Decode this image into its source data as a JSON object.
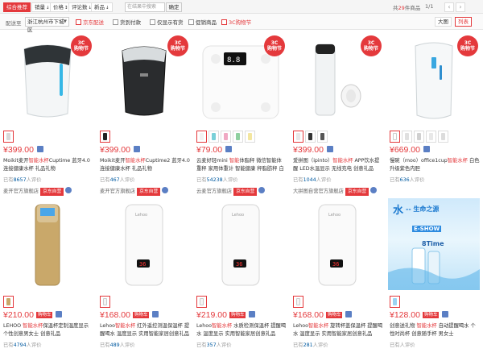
{
  "filters": {
    "sort": [
      {
        "label": "综合推荐",
        "active": true
      },
      {
        "label": "销量",
        "arrow": "↓"
      },
      {
        "label": "价格",
        "arrow": "↕"
      },
      {
        "label": "评论数",
        "arrow": "↓"
      },
      {
        "label": "新品",
        "arrow": "↓"
      }
    ],
    "search_placeholder": "在结果中搜索",
    "confirm_label": "确定",
    "count_prefix": "共",
    "count": "29",
    "count_suffix": "件商品",
    "page": "1/1",
    "prev": "‹",
    "next": "›"
  },
  "options": {
    "ship_label": "配送至",
    "location": "浙江杭州市下城区",
    "checks": [
      {
        "label": "京东配送",
        "red": true
      },
      {
        "label": "货到付款"
      },
      {
        "label": "仅显示有货"
      },
      {
        "label": "促销商品"
      },
      {
        "label": "3C购物节",
        "red": true
      }
    ],
    "view_large": "大图",
    "view_list": "列表"
  },
  "products": [
    {
      "price": "¥399.00",
      "badge": "3C\n购物节",
      "title_pre": "Moikit麦开",
      "title_hl": "智能水杯",
      "title_post": "Cuptime 蓝牙4.0连接健康水杯 礼品礼物",
      "sold_pre": "已有",
      "sold": "8657",
      "sold_post": "人评价",
      "shop": "麦开官方旗舰店",
      "self": "京东自营",
      "thumbs": [
        "#d9d9d9"
      ]
    },
    {
      "price": "¥399.00",
      "badge": "3C\n购物节",
      "title_pre": "Moikit麦开",
      "title_hl": "智能水杯",
      "title_post": "Cuptime2 蓝牙4.0连接健康水杯 礼品礼物",
      "sold_pre": "已有",
      "sold": "467",
      "sold_post": "人评价",
      "shop": "麦开官方旗舰店",
      "self": "京东自营",
      "thumbs": [
        "#222222"
      ]
    },
    {
      "price": "¥79.00",
      "badge": "3C\n购物节",
      "title_pre": "云麦好轻mini ",
      "title_hl": "智能",
      "title_post": "体脂秤 微信智能体重秤 家用体重计 智能健康 秤脂肪秤 白色",
      "sold_pre": "已有",
      "sold": "54238",
      "sold_post": "人评价",
      "shop": "云麦官方旗舰店",
      "self": "京东自营",
      "thumbs": [
        "#f2f2f2",
        "#7ad0d8",
        "#f0a9c3",
        "#8fd0a0",
        "#f3e6a0"
      ]
    },
    {
      "price": "¥399.00",
      "badge": "3C\n购物节",
      "title_pre": "爱拼图（ipinto）",
      "title_hl": "智能水杯",
      "title_post": " APP饮水提醒 LED水温显示 无线充电 创意礼品",
      "sold_pre": "已有",
      "sold": "1044",
      "sold_post": "人评价",
      "shop": "大拼图自营官方旗舰店",
      "self": "京东自营",
      "thumbs": [
        "#e8e8e8",
        "#333333",
        "#555555"
      ]
    },
    {
      "price": "¥669.00",
      "badge": "3C\n购物节",
      "title_pre": "慢碗（moo）office1cup",
      "title_hl": "智能水杯",
      "title_post": " 白色 升级紫色内胆",
      "sold_pre": "已有",
      "sold": "636",
      "sold_post": "人评价",
      "shop": "",
      "self": "",
      "thumbs": [
        "#ffffff",
        "#e0e0e0",
        "#d0d0d0",
        "#e8e8e8",
        "#dcdcdc"
      ]
    },
    {
      "price": "¥210.00",
      "tag": "购物车",
      "title_pre": "LEHOO ",
      "title_hl": "智能水杯",
      "title_post": "保温杯定制温度显示个性创意男女士 创意礼品",
      "sold_pre": "已有",
      "sold": "4794",
      "sold_post": "人评价",
      "shop": "",
      "self": "",
      "thumbs": [
        "#c9a86a"
      ]
    },
    {
      "price": "¥168.00",
      "tag": "购物车",
      "title_pre": "Lehoo",
      "title_hl": "智能水杯",
      "title_post": " 红外遥控测温保温杯 提醒喝水 温度显示 实用智能家居创意礼品",
      "sold_pre": "已有",
      "sold": "489",
      "sold_post": "人评价",
      "shop": "",
      "self": "",
      "thumbs": [
        "#f5f5f5"
      ]
    },
    {
      "price": "¥219.00",
      "tag": "购物车",
      "title_pre": "Lehoo",
      "title_hl": "智能水杯",
      "title_post": " 水质检测保温杯 提醒喝水 温度显示 实用智能家居创意礼品",
      "sold_pre": "已有",
      "sold": "357",
      "sold_post": "人评价",
      "shop": "",
      "self": "",
      "thumbs": [
        "#f5f5f5"
      ]
    },
    {
      "price": "¥168.00",
      "tag": "购物车",
      "title_pre": "Lehoo",
      "title_hl": "智能水杯",
      "title_post": " 旋转杯盖保温杯 提醒喝水 温度显示 实用智能家居创意礼品",
      "sold_pre": "已有",
      "sold": "281",
      "sold_post": "人评价",
      "shop": "",
      "self": "",
      "thumbs": [
        "#f5f5f5"
      ]
    },
    {
      "price": "¥128.00",
      "tag": "购物车",
      "title_pre": "创意送礼物 ",
      "title_hl": "智能水杯",
      "title_post": " 自动提醒喝水 个性时尚杯 创意随手杯 男女士",
      "sold_pre": "已有",
      "sold": "",
      "sold_post": "人评价",
      "shop": "",
      "self": "",
      "thumbs": [
        "#9bd3f2"
      ],
      "banner": {
        "t1": "水",
        "t2": "-- 生命之源",
        "t3": "E-SHOW",
        "t4": "8Time"
      }
    }
  ],
  "colors": {
    "accent": "#e4393c",
    "link": "#005aa0"
  }
}
